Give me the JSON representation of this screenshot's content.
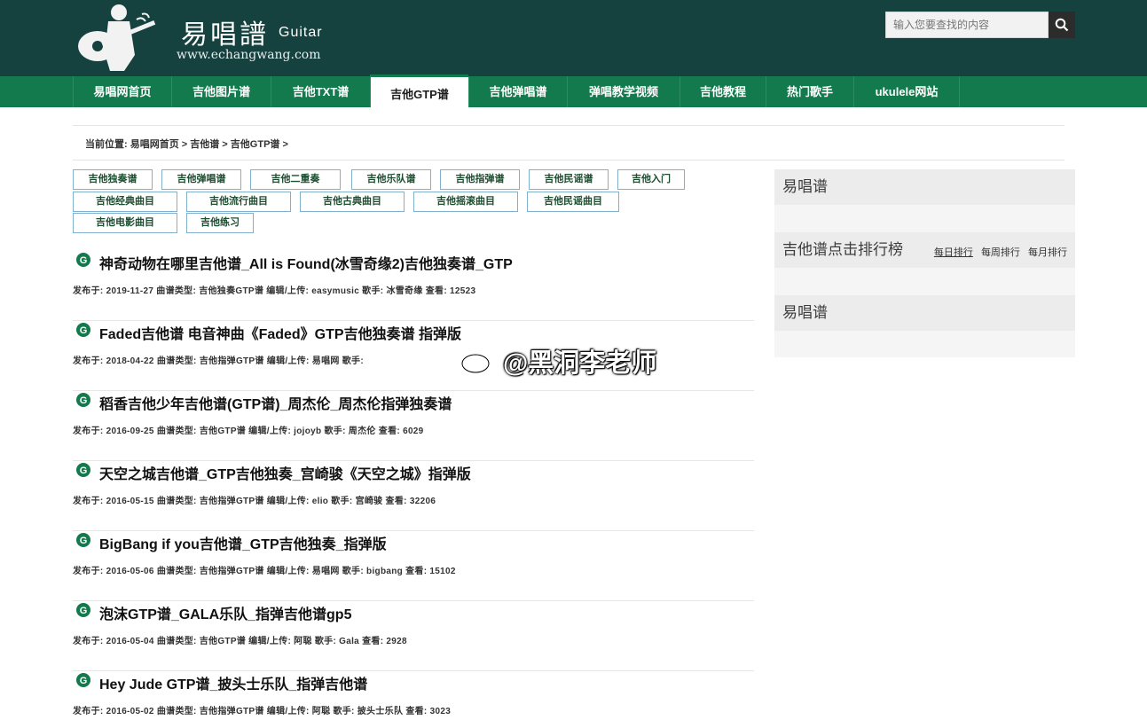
{
  "header": {
    "logo_title": "易唱譜",
    "logo_sub": "Guitar",
    "logo_url": "www.echangwang.com",
    "search_placeholder": "输入您要查找的内容",
    "brand_color": "#15413f"
  },
  "nav": {
    "accent_color": "#127a4c",
    "items": [
      {
        "label": "易唱网首页"
      },
      {
        "label": "吉他图片谱"
      },
      {
        "label": "吉他TXT谱"
      },
      {
        "label": "吉他GTP谱"
      },
      {
        "label": "吉他弹唱谱"
      },
      {
        "label": "弹唱教学视频"
      },
      {
        "label": "吉他教程"
      },
      {
        "label": "热门歌手"
      },
      {
        "label": "ukulele网站"
      }
    ],
    "active_index": 3
  },
  "breadcrumb": "当前位置: 易唱网首页 > 吉他谱 > 吉他GTP谱 >",
  "tags": [
    "吉他独奏谱",
    "吉他弹唱谱",
    "吉他二重奏",
    "吉他乐队谱",
    "吉他指弹谱",
    "吉他民谣谱",
    "吉他入门",
    "吉他经典曲目",
    "吉他流行曲目",
    "吉他古典曲目",
    "吉他摇滚曲目",
    "吉他民谣曲目",
    "吉他电影曲目",
    "吉他练习"
  ],
  "articles": [
    {
      "title": "神奇动物在哪里吉他谱_All is Found(冰雪奇缘2)吉他独奏谱_GTP",
      "meta": "发布于: 2019-11-27  曲谱类型: 吉他独奏GTP谱  编辑/上传: easymusic  歌手: 冰雪奇缘  查看: 12523"
    },
    {
      "title": "Faded吉他谱 电音神曲《Faded》GTP吉他独奏谱 指弹版",
      "meta": "发布于: 2018-04-22  曲谱类型: 吉他指弹GTP谱  编辑/上传: 易唱网  歌手:"
    },
    {
      "title": "稻香吉他少年吉他谱(GTP谱)_周杰伦_周杰伦指弹独奏谱",
      "meta": "发布于: 2016-09-25  曲谱类型: 吉他GTP谱  编辑/上传: jojoyb  歌手: 周杰伦  查看: 6029"
    },
    {
      "title": "天空之城吉他谱_GTP吉他独奏_宫崎骏《天空之城》指弹版",
      "meta": "发布于: 2016-05-15  曲谱类型: 吉他指弹GTP谱  编辑/上传: elio  歌手: 宫崎骏  查看: 32206"
    },
    {
      "title": "BigBang if you吉他谱_GTP吉他独奏_指弹版",
      "meta": "发布于: 2016-05-06  曲谱类型: 吉他指弹GTP谱  编辑/上传: 易唱网  歌手: bigbang  查看: 15102"
    },
    {
      "title": "泡沫GTP谱_GALA乐队_指弹吉他谱gp5",
      "meta": "发布于: 2016-05-04  曲谱类型: 吉他GTP谱  编辑/上传: 阿聪  歌手: Gala  查看: 2928"
    },
    {
      "title": "Hey Jude GTP谱_披头士乐队_指弹吉他谱",
      "meta": "发布于: 2016-05-02  曲谱类型: 吉他指弹GTP谱  编辑/上传: 阿聪  歌手: 披头士乐队  查看: 3023"
    }
  ],
  "sidebar": {
    "block1_title": "易唱谱",
    "rank_title": "吉他谱点击排行榜",
    "rank_tabs": [
      "每日排行",
      "每周排行",
      "每月排行"
    ],
    "block3_title": "易唱谱"
  },
  "watermark": "@黑洞李老师"
}
